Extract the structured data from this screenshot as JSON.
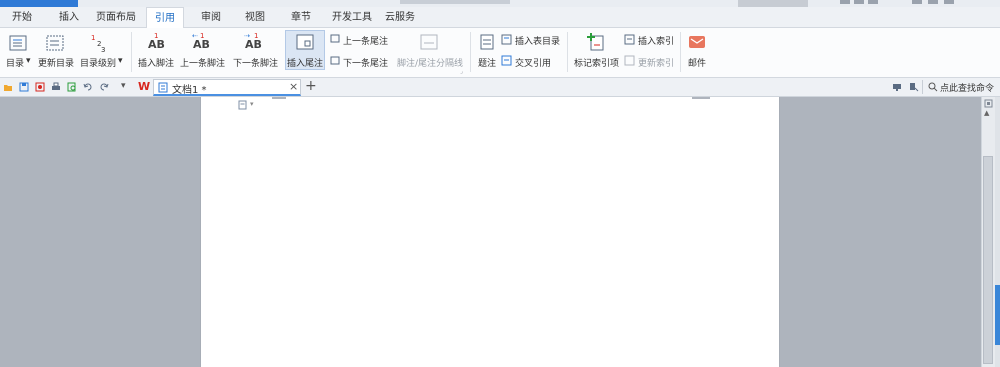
{
  "menu": {
    "tabs": [
      "开始",
      "插入",
      "页面布局",
      "引用",
      "审阅",
      "视图",
      "章节",
      "开发工具",
      "云服务"
    ],
    "active_tab": "引用"
  },
  "ribbon": {
    "toc_label": "目录",
    "update_toc_label": "更新目录",
    "toc_level_label": "目录级别",
    "insert_footnote_label": "插入脚注",
    "prev_footnote_label": "上一条脚注",
    "next_footnote_label": "下一条脚注",
    "insert_endnote_label": "插入尾注",
    "prev_endnote_label": "上一条尾注",
    "next_endnote_label": "下一条尾注",
    "footnote_separator_label": "脚注/尾注分隔线",
    "caption_label": "题注",
    "insert_table_of_figures_label": "插入表目录",
    "cross_reference_label": "交叉引用",
    "mark_index_entry_label": "标记索引项",
    "insert_index_label": "插入索引",
    "update_index_label": "更新索引",
    "mail_label": "邮件",
    "ab_text": "AB",
    "footnote_num": "1",
    "toc_levels": [
      "1",
      "2",
      "3"
    ]
  },
  "quickbar": {
    "doc_tab_title": "文档1 *",
    "wps_logo": "W",
    "close_glyph": "×",
    "add_glyph": "+",
    "search_placeholder": "点此查找命令"
  },
  "colors": {
    "accent": "#2f7ad6",
    "wps_red": "#d7261e",
    "mail_orange": "#e8765e"
  }
}
